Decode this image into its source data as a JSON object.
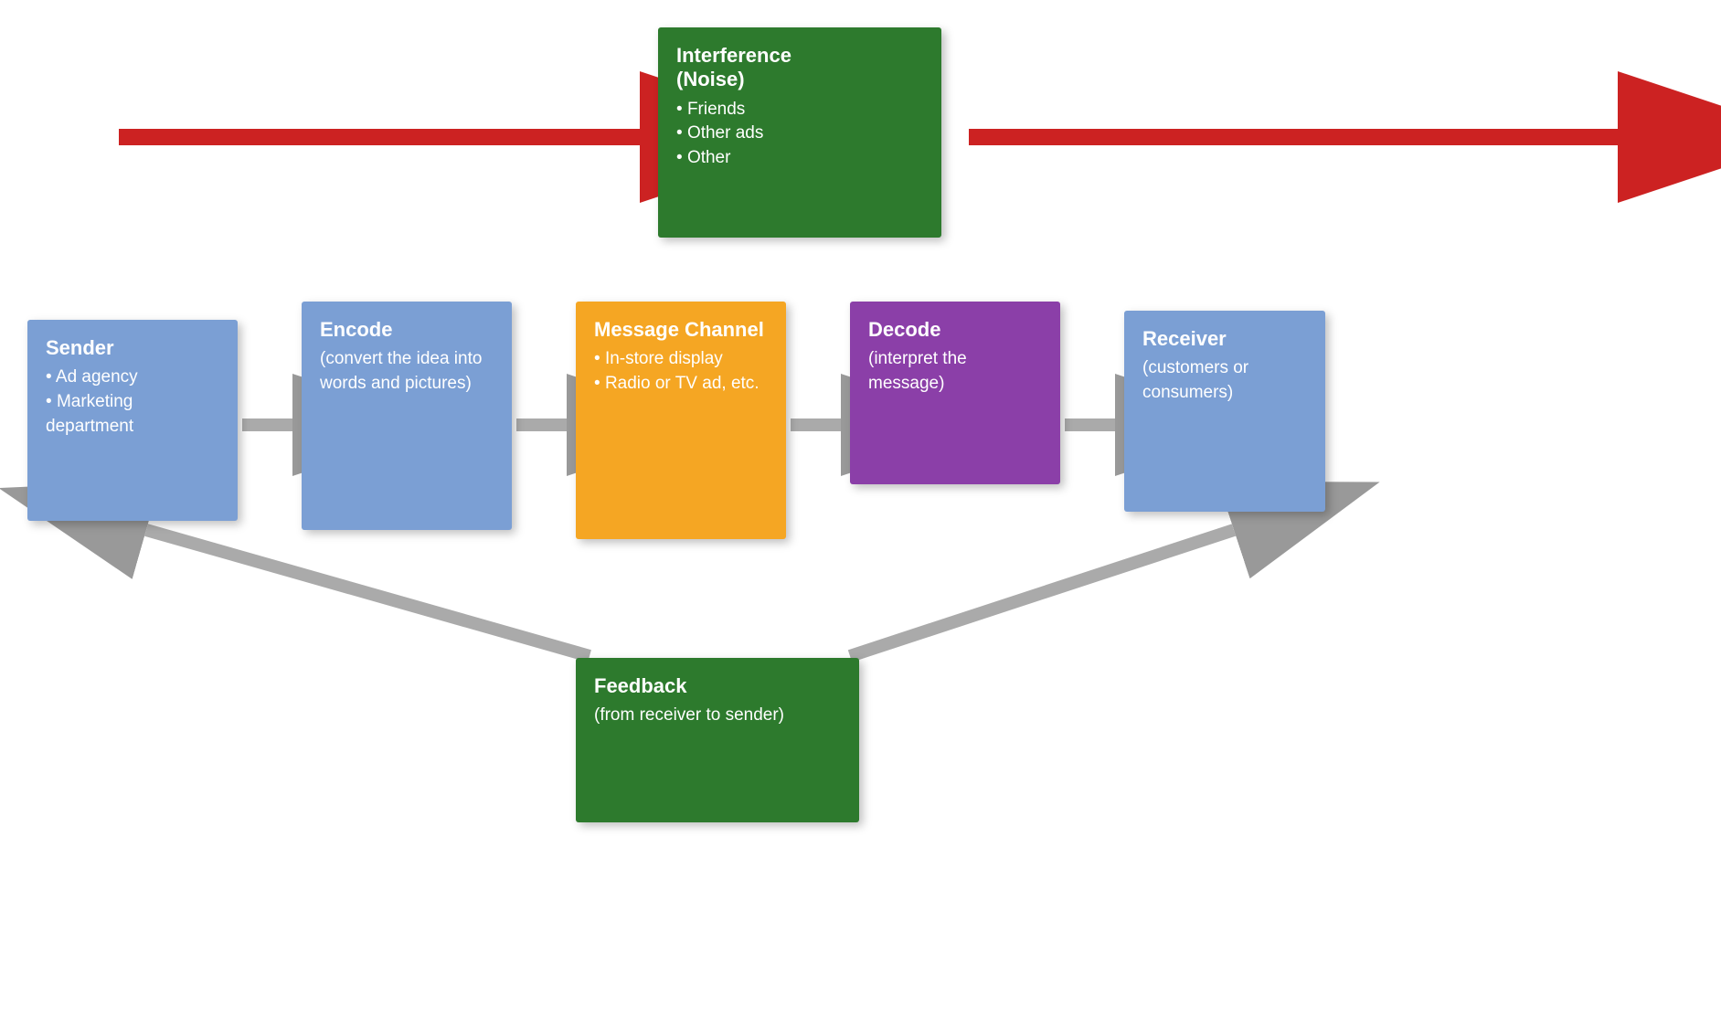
{
  "noise": {
    "title": "Interference\n(Noise)",
    "items": [
      "Friends",
      "Other ads",
      "Other"
    ]
  },
  "sender": {
    "title": "Sender",
    "items": [
      "Ad agency",
      "Marketing department"
    ]
  },
  "encode": {
    "title": "Encode",
    "subtitle": "(convert the idea into words and pictures)"
  },
  "channel": {
    "title": "Message Channel",
    "items": [
      "In-store display",
      "Radio or TV ad, etc."
    ]
  },
  "decode": {
    "title": "Decode",
    "subtitle": "(interpret the message)"
  },
  "receiver": {
    "title": "Receiver",
    "subtitle": "(customers or consumers)"
  },
  "feedback": {
    "title": "Feedback",
    "subtitle": "(from receiver to sender)"
  }
}
